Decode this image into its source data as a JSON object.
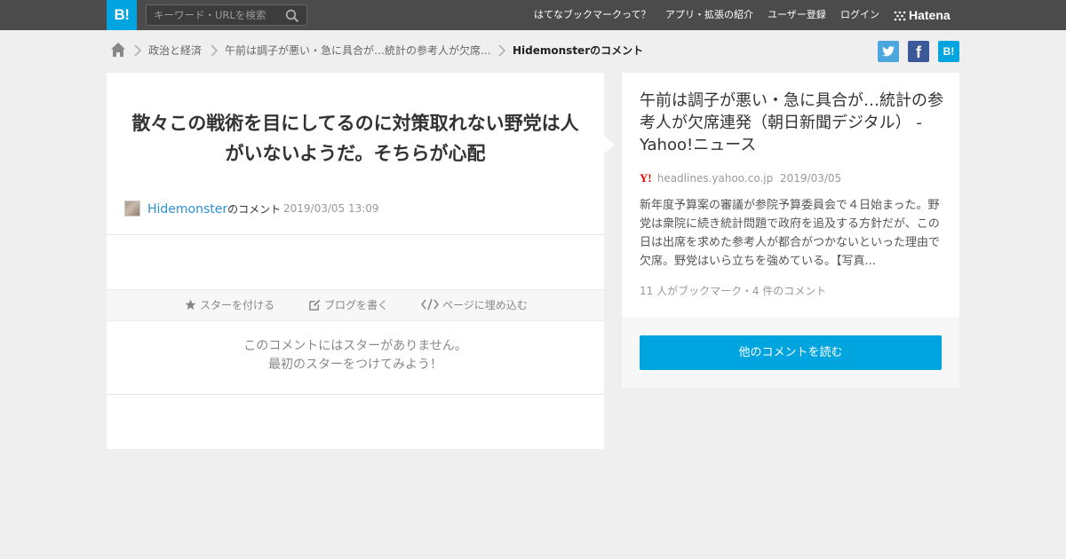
{
  "header": {
    "logo": "B!",
    "search_placeholder": "キーワード・URLを検索",
    "nav": [
      "はてなブックマークって？",
      "アプリ・拡張の紹介",
      "ユーザー登録",
      "ログイン"
    ],
    "brand": "Hatena"
  },
  "breadcrumb": {
    "items": [
      "政治と経済",
      "午前は調子が悪い・急に具合が…統計の参考人が欠席...",
      "Hidemonsterのコメント"
    ]
  },
  "comment": {
    "text": "散々この戦術を目にしてるのに対策取れない野党は人がいないようだ。そちらが心配",
    "user": "Hidemonster",
    "user_suffix": "のコメント",
    "date": "2019/03/05 13:09",
    "actions": {
      "star": "スターを付ける",
      "blog": "ブログを書く",
      "embed": "ページに埋め込む"
    },
    "no_star_line1": "このコメントにはスターがありません。",
    "no_star_line2": "最初のスターをつけてみよう！"
  },
  "entry": {
    "title": "午前は調子が悪い・急に具合が…統計の参考人が欠席連発（朝日新聞デジタル） - Yahoo!ニュース",
    "source_logo": "Y!",
    "source": "headlines.yahoo.co.jp",
    "date": "2019/03/05",
    "summary": "新年度予算案の審議が参院予算委員会で４日始まった。野党は衆院に続き統計問題で政府を追及する方針だが、この日は出席を求めた参考人が都合がつかないといった理由で欠席。野党はいら立ちを強めている。【写真...",
    "meta": "11 人がブックマーク・4 件のコメント",
    "read_button": "他のコメントを読む"
  },
  "colors": {
    "accent": "#00a4de",
    "header": "#4b4b4b",
    "link": "#2a91d6"
  }
}
